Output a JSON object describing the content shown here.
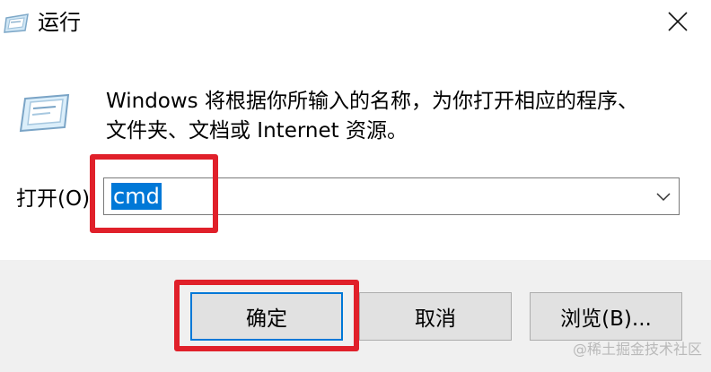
{
  "window": {
    "title": "运行"
  },
  "description": {
    "line1": "Windows 将根据你所输入的名称，为你打开相应的程序、",
    "line2": "文件夹、文档或 Internet 资源。"
  },
  "open_field": {
    "label": "打开(O):",
    "value": "cmd"
  },
  "buttons": {
    "ok": "确定",
    "cancel": "取消",
    "browse": "浏览(B)..."
  },
  "watermark": "@稀土掘金技术社区",
  "colors": {
    "selection": "#0078d7",
    "highlight_box": "#e0202a",
    "button_face": "#e1e1e1",
    "footer_bg": "#f0f0f0"
  },
  "icons": {
    "app": "run-app-icon",
    "close": "close-icon",
    "dropdown": "chevron-down-icon",
    "large": "run-dialog-icon"
  }
}
